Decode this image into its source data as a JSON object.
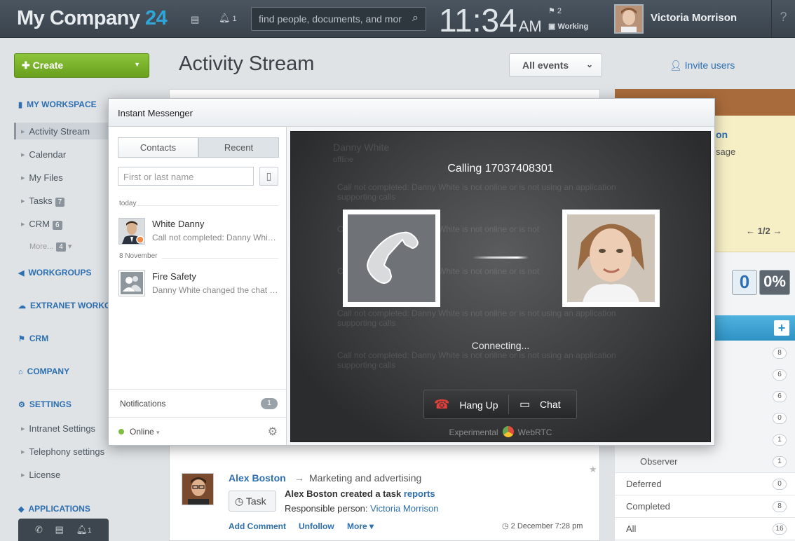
{
  "header": {
    "logo_main": "My Company ",
    "logo_num": "24",
    "chat_icon": "chat-icon",
    "bell_count": "1",
    "search_placeholder": "find people, documents, and mor",
    "time": "11:34",
    "ampm": "AM",
    "flag_count": "2",
    "work_status": "Working",
    "user_name": "Victoria Morrison",
    "help": "?"
  },
  "sidebar": {
    "create_label": "Create",
    "my_workspace": "MY WORKSPACE",
    "items": [
      {
        "label": "Activity Stream"
      },
      {
        "label": "Calendar"
      },
      {
        "label": "My Files"
      },
      {
        "label": "Tasks",
        "badge": "7"
      },
      {
        "label": "CRM",
        "badge": "6"
      },
      {
        "label": "More...",
        "badge": "4"
      }
    ],
    "workgroups": "WORKGROUPS",
    "extranet": "EXTRANET WORKGR",
    "crm": "CRM",
    "company": "COMPANY",
    "settings": "SETTINGS",
    "settings_items": [
      {
        "label": "Intranet Settings"
      },
      {
        "label": "Telephony settings"
      },
      {
        "label": "License"
      }
    ],
    "applications": "APPLICATIONS",
    "bottom_bell": "1"
  },
  "main": {
    "title": "Activity Stream",
    "filter": "All events",
    "invite": "Invite users"
  },
  "right": {
    "on_text": "on",
    "sage_text": "sage",
    "pager": "1/2",
    "counter_a": "0",
    "counter_b": "0%",
    "rows": [
      {
        "count": "8"
      },
      {
        "count": "6"
      },
      {
        "count": "6"
      },
      {
        "count": "0"
      },
      {
        "count": "1"
      }
    ],
    "observer": {
      "label": "Observer",
      "count": "1"
    },
    "deferred": {
      "label": "Deferred",
      "count": "0"
    },
    "completed": {
      "label": "Completed",
      "count": "8"
    },
    "all": {
      "label": "All",
      "count": "16"
    }
  },
  "messenger": {
    "title": "Instant Messenger",
    "tab_contacts": "Contacts",
    "tab_recent": "Recent",
    "search_placeholder": "First or last name",
    "group_today": "today",
    "group_nov": "8 November",
    "contacts": [
      {
        "name": "White Danny",
        "msg": "Call not completed: Danny White is not online or is not using"
      },
      {
        "name": "Fire Safety",
        "msg": "Danny White changed the chat title"
      }
    ],
    "notifications": "Notifications",
    "notif_count": "1",
    "status": "Online"
  },
  "call": {
    "ghost_name": "Danny White",
    "ghost_sub": "offline",
    "ghost_msg": "Call not completed: Danny White is not online or is not using an application supporting calls",
    "ghost_msg_short": "Call not completed: Danny White is not online or is not",
    "calling": "Calling 17037408301",
    "connecting": "Connecting...",
    "hangup": "Hang Up",
    "chat": "Chat",
    "experimental": "Experimental",
    "webrtc": "WebRTC"
  },
  "post": {
    "author": "Alex Boston",
    "destination": "Marketing and advertising",
    "badge": "Task",
    "created": "Alex Boston created a task",
    "task_name": "reports",
    "responsible_label": "Responsible person:",
    "responsible": "Victoria Morrison",
    "add_comment": "Add Comment",
    "unfollow": "Unfollow",
    "more": "More",
    "date": "2 December 7:28 pm"
  },
  "colors": {
    "accent": "#2d6fb0",
    "create": "#7ab42c",
    "logo_num": "#2fa6d9"
  }
}
